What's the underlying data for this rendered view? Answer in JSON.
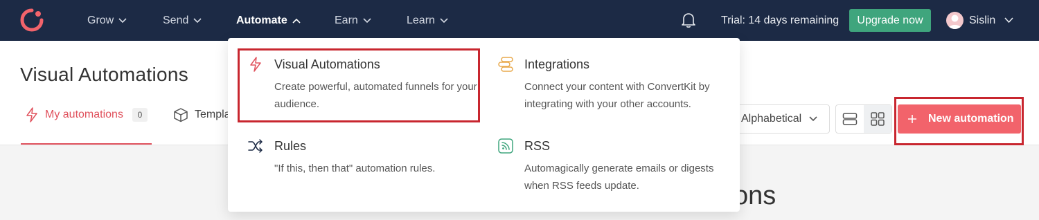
{
  "nav": {
    "items": [
      {
        "label": "Grow"
      },
      {
        "label": "Send"
      },
      {
        "label": "Automate"
      },
      {
        "label": "Earn"
      },
      {
        "label": "Learn"
      }
    ],
    "trial_text": "Trial: 14 days remaining",
    "upgrade_label": "Upgrade now",
    "username": "Sislin"
  },
  "page": {
    "title": "Visual Automations",
    "tabs": [
      {
        "label": "My automations",
        "count": "0"
      },
      {
        "label": "Templa"
      }
    ],
    "sort_value": "Alphabetical",
    "new_button_label": "New automation",
    "background_heading": "tions"
  },
  "menu": {
    "items": [
      {
        "title": "Visual Automations",
        "desc": "Create powerful, automated funnels for your audience.",
        "icon": "lightning-icon"
      },
      {
        "title": "Integrations",
        "desc": "Connect your content with ConvertKit by integrating with your other accounts.",
        "icon": "integrations-icon"
      },
      {
        "title": "Rules",
        "desc": "\"If this, then that\" automation rules.",
        "icon": "shuffle-icon"
      },
      {
        "title": "RSS",
        "desc": "Automagically generate emails or digests when RSS feeds update.",
        "icon": "rss-icon"
      }
    ]
  },
  "colors": {
    "navbar": "#1c2a45",
    "accent": "#f2636b",
    "upgrade": "#3fa57d",
    "highlight": "#c8262f"
  }
}
